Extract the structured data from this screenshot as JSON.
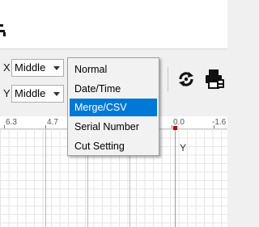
{
  "toolbar": {
    "x_label": "X",
    "y_label": "Y",
    "x_align": {
      "value": "Middle"
    },
    "y_align": {
      "value": "Middle"
    },
    "icons": [
      "refresh-icon",
      "printer-settings-icon"
    ]
  },
  "ruler": {
    "ticks": [
      "6.3",
      "4.7",
      "0.0",
      "-1.6"
    ]
  },
  "canvas": {
    "y_axis_label": "Y"
  },
  "dropdown_menu": {
    "items": [
      "Normal",
      "Date/Time",
      "Merge/CSV",
      "Serial Number",
      "Cut Setting"
    ],
    "selected": "Merge/CSV",
    "highlight_color": "#0078d7"
  }
}
